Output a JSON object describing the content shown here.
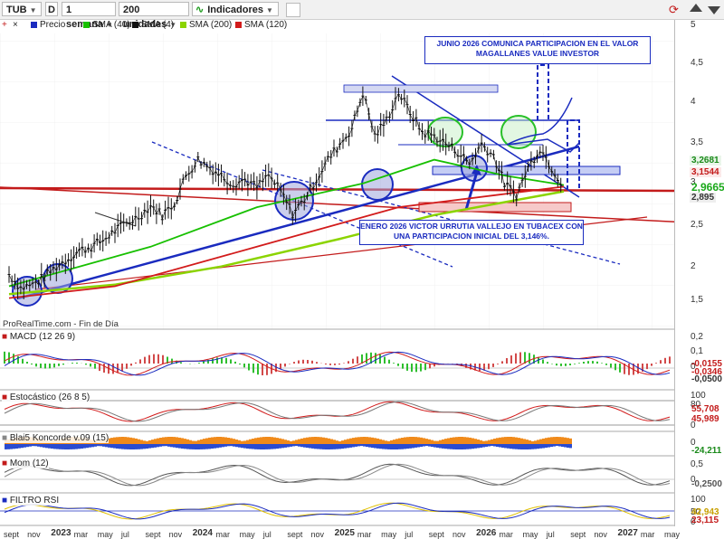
{
  "toolbar": {
    "symbol": "TUB",
    "d_button": "D",
    "timeframe": "1 semana",
    "units": "200 unidades",
    "indicators": "Indicadores"
  },
  "legend": {
    "price_label": "Precio",
    "sma40": "SMA (40)",
    "sma4": "SMA (4)",
    "sma200": "SMA (200)",
    "sma120": "SMA (120)"
  },
  "colors": {
    "sma40": "#17c000",
    "sma4": "#111111",
    "sma200": "#8bd400",
    "sma120": "#d21b1b",
    "trend_blue": "#1a2bbf"
  },
  "footer_source": "ProRealTime.com - Fin de Día",
  "annotations": {
    "top": "JUNIO 2026 COMUNICA PARTICIPACION EN EL VALOR MAGALLANES VALUE INVESTOR",
    "bottom": "ENERO 2026 VICTOR URRUTIA VALLEJO EN TUBACEX CON UNA PARTICIPACION INICIAL DEL 3,146%."
  },
  "price_axis": {
    "ticks": [
      "5",
      "4,5",
      "4",
      "3,5",
      "3",
      "2,5",
      "2",
      "1,5"
    ],
    "tags": [
      {
        "text": "3,2681",
        "color": "#1a8a1a"
      },
      {
        "text": "3,1544",
        "color": "#c31b1b"
      },
      {
        "text": "2,9665",
        "color": "#1aa81a"
      },
      {
        "text": "2,895",
        "color": "#333333"
      }
    ]
  },
  "panels": {
    "macd": {
      "title": "MACD (12 26 9)",
      "ticks": [
        "0,2",
        "0,1",
        "0"
      ],
      "tags": [
        "-0,0155",
        "-0,0346",
        "-0,0500"
      ]
    },
    "stoch": {
      "title": "Estocástico (26 8 5)",
      "ticks": [
        "100",
        "80",
        "0"
      ],
      "tags": [
        "55,708",
        "45,989"
      ]
    },
    "koncorde": {
      "title": "Blai5 Koncorde v.09 (15)",
      "ticks": [
        "0"
      ],
      "tags": [
        "-24,211"
      ]
    },
    "mom": {
      "title": "Mom (12)",
      "ticks": [
        "0,5",
        "0"
      ],
      "tags": [
        "-0,2500"
      ]
    },
    "rsi": {
      "title": "FILTRO RSI",
      "ticks": [
        "100",
        "50",
        "0"
      ],
      "tags": [
        "42,943",
        "23,115"
      ]
    }
  },
  "time_axis": [
    {
      "t": "sept",
      "yr": false
    },
    {
      "t": "nov",
      "yr": false
    },
    {
      "t": "2023",
      "yr": true
    },
    {
      "t": "mar",
      "yr": false
    },
    {
      "t": "may",
      "yr": false
    },
    {
      "t": "jul",
      "yr": false
    },
    {
      "t": "sept",
      "yr": false
    },
    {
      "t": "nov",
      "yr": false
    },
    {
      "t": "2024",
      "yr": true
    },
    {
      "t": "mar",
      "yr": false
    },
    {
      "t": "may",
      "yr": false
    },
    {
      "t": "jul",
      "yr": false
    },
    {
      "t": "sept",
      "yr": false
    },
    {
      "t": "nov",
      "yr": false
    },
    {
      "t": "2025",
      "yr": true
    },
    {
      "t": "mar",
      "yr": false
    },
    {
      "t": "may",
      "yr": false
    },
    {
      "t": "jul",
      "yr": false
    },
    {
      "t": "sept",
      "yr": false
    },
    {
      "t": "nov",
      "yr": false
    },
    {
      "t": "2026",
      "yr": true
    },
    {
      "t": "mar",
      "yr": false
    },
    {
      "t": "may",
      "yr": false
    },
    {
      "t": "jul",
      "yr": false
    },
    {
      "t": "sept",
      "yr": false
    },
    {
      "t": "nov",
      "yr": false
    },
    {
      "t": "2027",
      "yr": true
    },
    {
      "t": "mar",
      "yr": false
    },
    {
      "t": "may",
      "yr": false
    }
  ],
  "chart_data": {
    "type": "line",
    "price_series": [
      [
        "2022-09-01",
        1.85
      ],
      [
        "2022-10-01",
        1.68
      ],
      [
        "2022-11-01",
        1.72
      ],
      [
        "2022-12-01",
        1.82
      ],
      [
        "2023-01-01",
        1.95
      ],
      [
        "2023-02-01",
        2.05
      ],
      [
        "2023-03-01",
        2.15
      ],
      [
        "2023-04-01",
        2.2
      ],
      [
        "2023-05-01",
        2.28
      ],
      [
        "2023-06-01",
        2.4
      ],
      [
        "2023-07-01",
        2.5
      ],
      [
        "2023-08-01",
        2.58
      ],
      [
        "2023-09-01",
        2.72
      ],
      [
        "2023-10-01",
        2.6
      ],
      [
        "2023-11-01",
        2.75
      ],
      [
        "2023-12-01",
        3.1
      ],
      [
        "2024-01-01",
        3.3
      ],
      [
        "2024-02-01",
        3.2
      ],
      [
        "2024-03-01",
        3.1
      ],
      [
        "2024-04-01",
        3.0
      ],
      [
        "2024-05-01",
        3.05
      ],
      [
        "2024-06-01",
        2.95
      ],
      [
        "2024-07-01",
        3.1
      ],
      [
        "2024-08-01",
        2.9
      ],
      [
        "2024-09-01",
        2.62
      ],
      [
        "2024-10-01",
        2.8
      ],
      [
        "2024-11-01",
        3.05
      ],
      [
        "2024-12-01",
        3.3
      ],
      [
        "2025-01-01",
        3.5
      ],
      [
        "2025-02-01",
        3.7
      ],
      [
        "2025-03-01",
        4.15
      ],
      [
        "2025-04-01",
        3.6
      ],
      [
        "2025-05-01",
        3.8
      ],
      [
        "2025-06-01",
        4.15
      ],
      [
        "2025-07-01",
        3.9
      ],
      [
        "2025-08-01",
        3.65
      ],
      [
        "2025-09-01",
        3.6
      ],
      [
        "2025-10-01",
        3.5
      ],
      [
        "2025-11-01",
        3.4
      ],
      [
        "2025-12-01",
        3.25
      ],
      [
        "2026-01-01",
        3.5
      ],
      [
        "2026-02-01",
        3.35
      ],
      [
        "2026-03-01",
        3.0
      ],
      [
        "2026-04-01",
        2.85
      ],
      [
        "2026-05-01",
        3.2
      ],
      [
        "2026-06-01",
        3.45
      ],
      [
        "2026-07-01",
        3.2
      ],
      [
        "2026-08-01",
        2.97
      ]
    ],
    "sma200": [
      [
        "2022-09-01",
        1.6
      ],
      [
        "2023-06-01",
        1.72
      ],
      [
        "2024-03-01",
        1.95
      ],
      [
        "2025-01-01",
        2.3
      ],
      [
        "2025-09-01",
        2.6
      ],
      [
        "2026-08-01",
        2.9
      ]
    ],
    "sma40": [
      [
        "2022-09-01",
        1.7
      ],
      [
        "2023-09-01",
        2.2
      ],
      [
        "2024-06-01",
        2.7
      ],
      [
        "2025-03-01",
        3.0
      ],
      [
        "2025-09-01",
        3.3
      ],
      [
        "2026-03-01",
        3.1
      ],
      [
        "2026-08-01",
        2.98
      ]
    ],
    "sma120": [
      [
        "2022-09-01",
        1.55
      ],
      [
        "2023-06-01",
        1.7
      ],
      [
        "2024-06-01",
        2.2
      ],
      [
        "2025-06-01",
        2.7
      ],
      [
        "2026-08-01",
        2.96
      ]
    ]
  }
}
